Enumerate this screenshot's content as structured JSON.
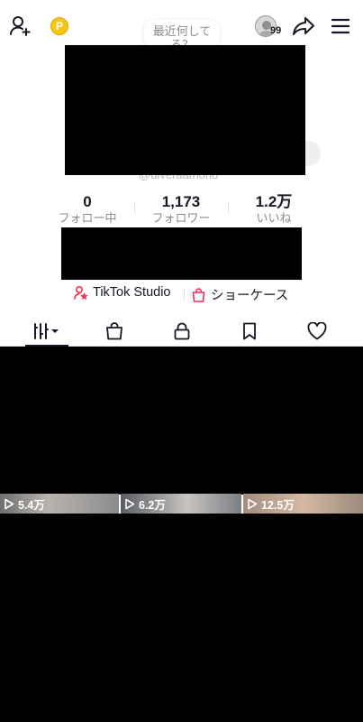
{
  "header": {
    "add_user_icon": "add-user-icon",
    "coin_label": "P",
    "recent_bubble": "最近何して\nる？",
    "avatar_badge": "99",
    "share_icon": "share-icon",
    "menu_icon": "menu-icon"
  },
  "profile": {
    "edit_hint": "集",
    "handle": "@diveraamono"
  },
  "stats": [
    {
      "value": "0",
      "label": "フォロー中"
    },
    {
      "value": "1,173",
      "label": "フォロワー"
    },
    {
      "value": "1.2万",
      "label": "いいね"
    }
  ],
  "links": {
    "studio": "TikTok Studio",
    "showcase": "ショーケース"
  },
  "tabs": [
    "videos",
    "shop",
    "private",
    "saved",
    "liked"
  ],
  "videos": [
    {
      "views": "5.4万"
    },
    {
      "views": "6.2万"
    },
    {
      "views": "12.5万"
    }
  ],
  "colors": {
    "brand_red": "#FE2C55",
    "coin_gold": "#F5C518",
    "text_primary": "#161823",
    "text_secondary": "#8A8B91"
  }
}
